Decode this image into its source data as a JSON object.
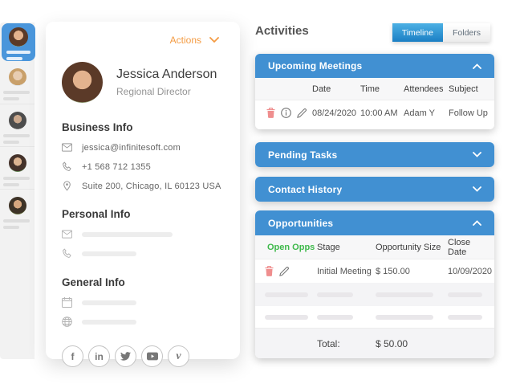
{
  "colors": {
    "accent_blue": "#4190d2",
    "tab_blue_top": "#4cb0e4",
    "tab_blue_bottom": "#1b7fc4",
    "sidebar_selected_blue": "#4a96db",
    "actions_orange": "#f49b42",
    "open_opps_green": "#3eb94b",
    "trash_red": "#ef8e8e"
  },
  "sidebar": {
    "items": [
      {
        "avatar": "avatar-photo",
        "selected": true
      },
      {
        "avatar": "avatar-photo",
        "selected": false
      },
      {
        "avatar": "avatar-photo",
        "selected": false
      },
      {
        "avatar": "avatar-photo",
        "selected": false
      },
      {
        "avatar": "avatar-photo",
        "selected": false
      }
    ]
  },
  "profile_card": {
    "actions_label": "Actions",
    "name": "Jessica Anderson",
    "title": "Regional Director",
    "business": {
      "heading": "Business Info",
      "email": "jessica@infinitesoft.com",
      "phone": "+1 568 712 1355",
      "address": "Suite 200, Chicago, IL 60123 USA"
    },
    "personal": {
      "heading": "Personal Info"
    },
    "general": {
      "heading": "General Info"
    },
    "social": [
      {
        "name": "facebook",
        "glyph": "f"
      },
      {
        "name": "linkedin",
        "glyph": "in"
      },
      {
        "name": "twitter",
        "glyph": ""
      },
      {
        "name": "youtube",
        "glyph": ""
      },
      {
        "name": "vimeo",
        "glyph": "v"
      }
    ]
  },
  "activities": {
    "title": "Activities",
    "tabs": [
      {
        "label": "Timeline",
        "active": true
      },
      {
        "label": "Folders",
        "active": false
      }
    ],
    "upcoming_meetings": {
      "heading": "Upcoming Meetings",
      "expanded": true,
      "columns": [
        "Date",
        "Time",
        "Attendees",
        "Subject"
      ],
      "rows": [
        {
          "date": "08/24/2020",
          "time": "10:00 AM",
          "attendees": "Adam Y",
          "subject": "Follow Up"
        }
      ]
    },
    "pending_tasks": {
      "heading": "Pending Tasks",
      "expanded": false
    },
    "contact_history": {
      "heading": "Contact History",
      "expanded": false
    },
    "opportunities": {
      "heading": "Opportunities",
      "expanded": true,
      "columns": [
        "Open Opps",
        "Stage",
        "Opportunity Size",
        "Close Date"
      ],
      "rows": [
        {
          "stage": "Initial Meeting",
          "size": "$ 150.00",
          "close_date": "10/09/2020"
        }
      ],
      "total_label": "Total:",
      "total_value": "$ 50.00"
    }
  }
}
